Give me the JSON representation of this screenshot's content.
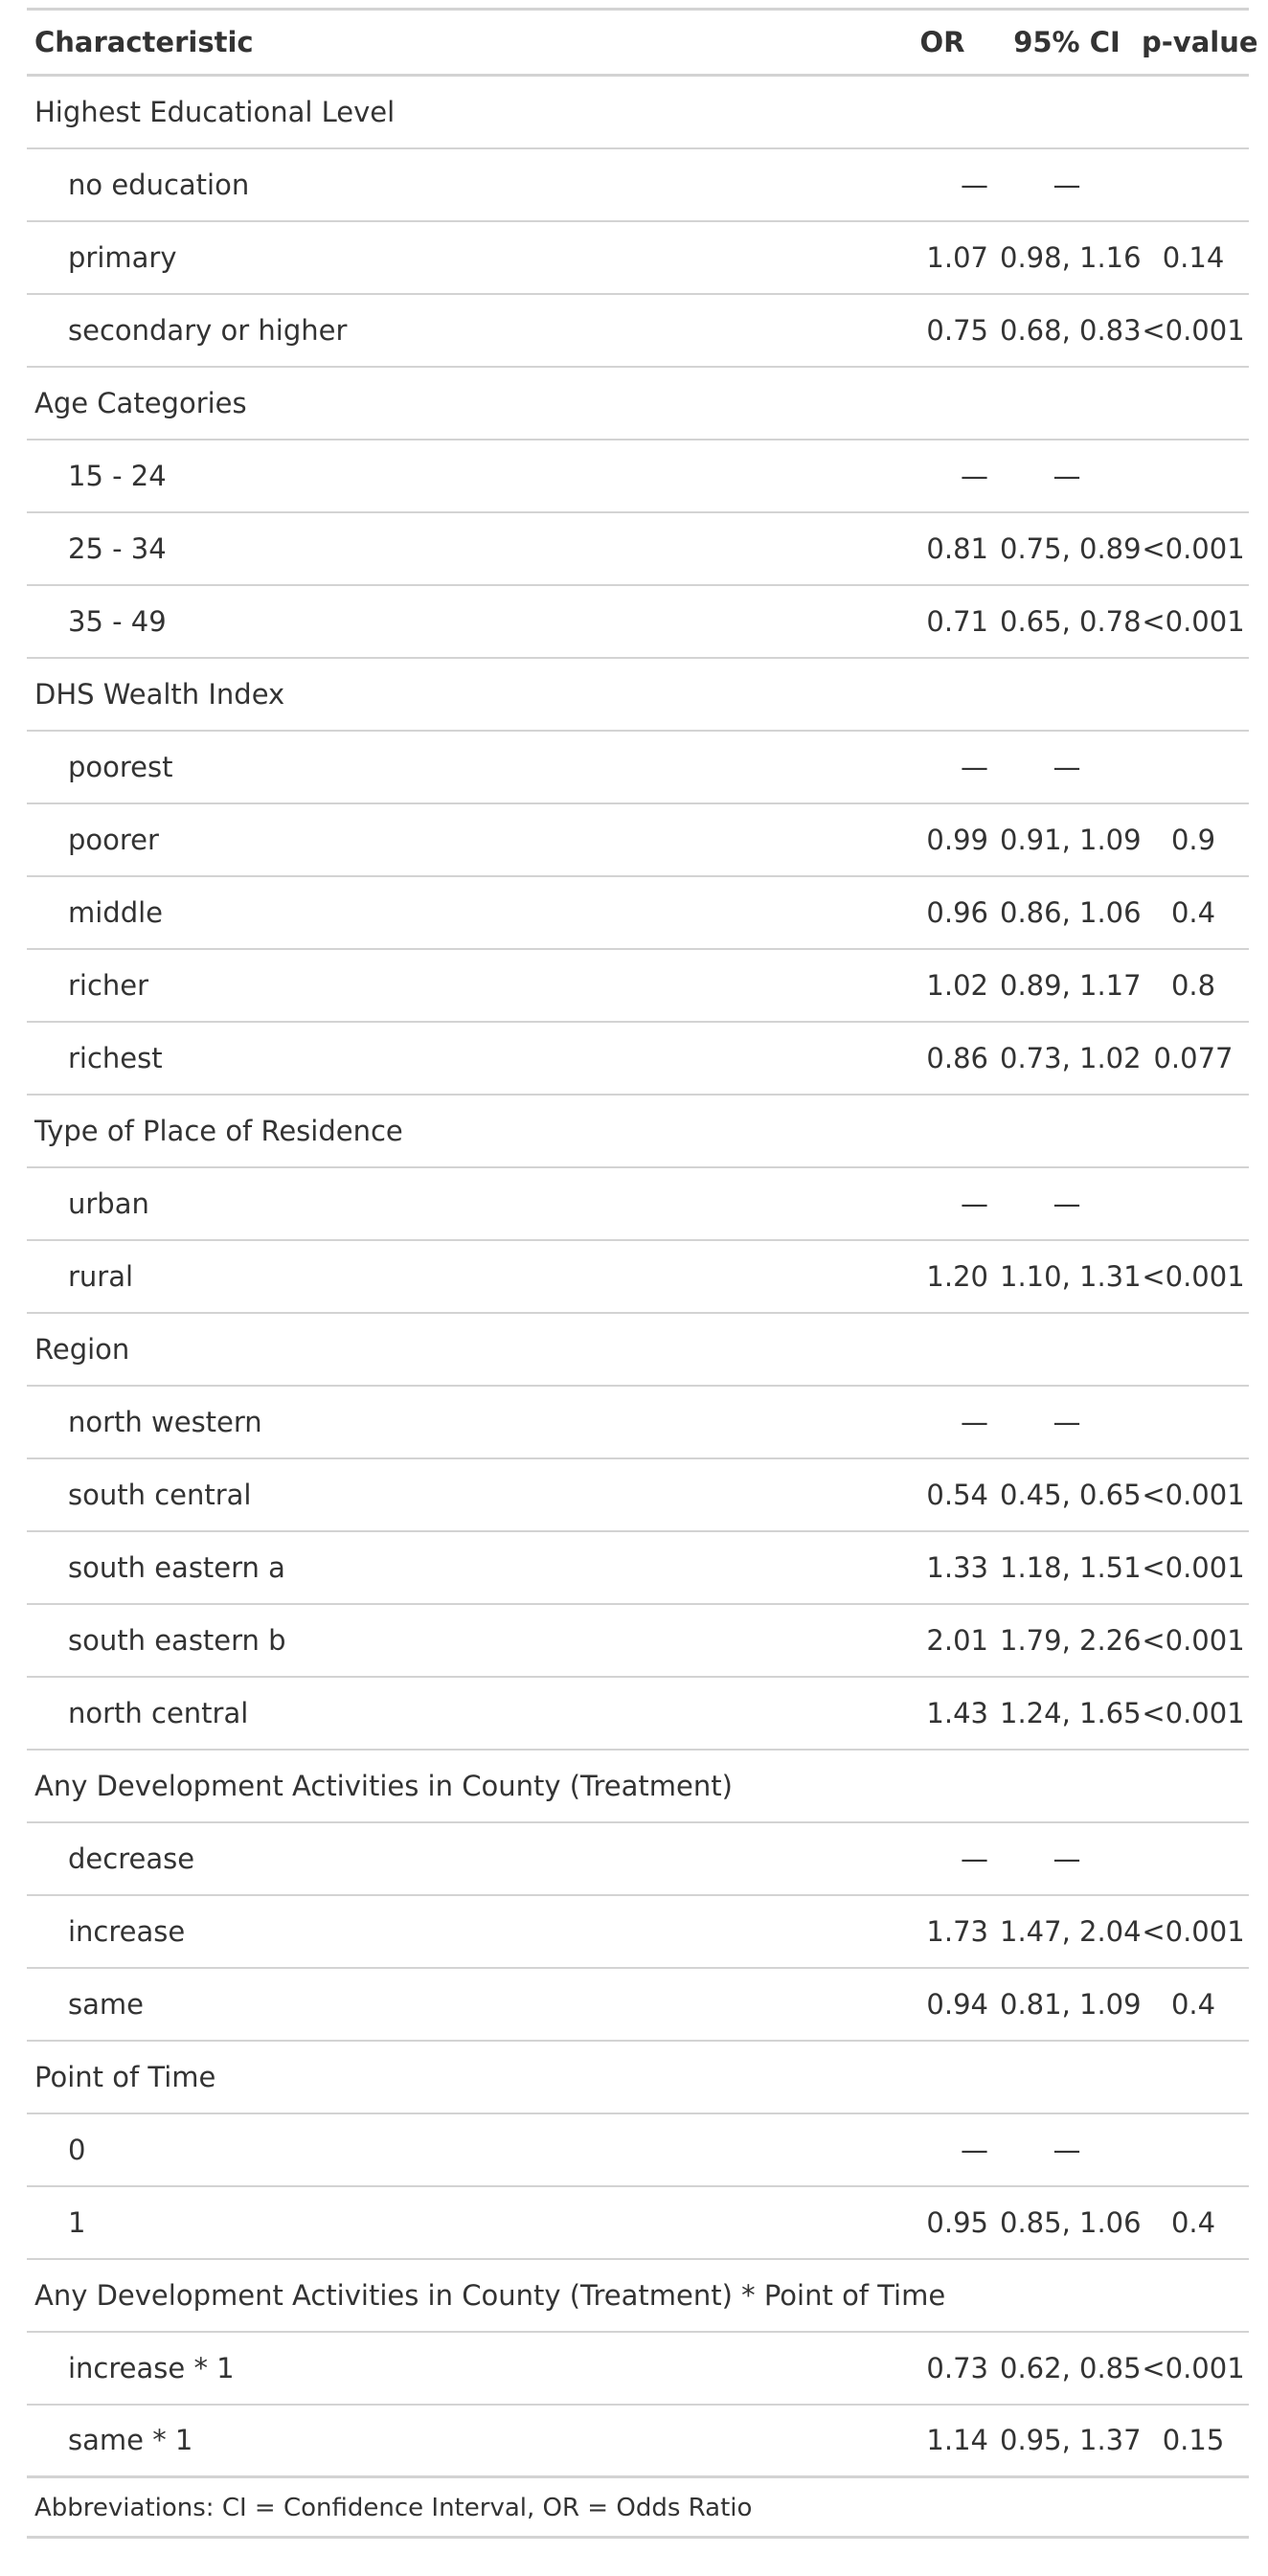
{
  "header": {
    "characteristic": "Characteristic",
    "or": "OR",
    "ci": "95% CI",
    "p": "p-value"
  },
  "rows": [
    {
      "kind": "group",
      "label": "Highest Educational Level",
      "or": "",
      "ci": "",
      "p": ""
    },
    {
      "kind": "level",
      "label": "no education",
      "or": "—",
      "ci": "—",
      "p": ""
    },
    {
      "kind": "level",
      "label": "primary",
      "or": "1.07",
      "ci": "0.98, 1.16",
      "p": "0.14"
    },
    {
      "kind": "level",
      "label": "secondary or higher",
      "or": "0.75",
      "ci": "0.68, 0.83",
      "p": "<0.001"
    },
    {
      "kind": "group",
      "label": "Age Categories",
      "or": "",
      "ci": "",
      "p": ""
    },
    {
      "kind": "level",
      "label": "15 - 24",
      "or": "—",
      "ci": "—",
      "p": ""
    },
    {
      "kind": "level",
      "label": "25 - 34",
      "or": "0.81",
      "ci": "0.75, 0.89",
      "p": "<0.001"
    },
    {
      "kind": "level",
      "label": "35 - 49",
      "or": "0.71",
      "ci": "0.65, 0.78",
      "p": "<0.001"
    },
    {
      "kind": "group",
      "label": "DHS Wealth Index",
      "or": "",
      "ci": "",
      "p": ""
    },
    {
      "kind": "level",
      "label": "poorest",
      "or": "—",
      "ci": "—",
      "p": ""
    },
    {
      "kind": "level",
      "label": "poorer",
      "or": "0.99",
      "ci": "0.91, 1.09",
      "p": "0.9"
    },
    {
      "kind": "level",
      "label": "middle",
      "or": "0.96",
      "ci": "0.86, 1.06",
      "p": "0.4"
    },
    {
      "kind": "level",
      "label": "richer",
      "or": "1.02",
      "ci": "0.89, 1.17",
      "p": "0.8"
    },
    {
      "kind": "level",
      "label": "richest",
      "or": "0.86",
      "ci": "0.73, 1.02",
      "p": "0.077"
    },
    {
      "kind": "group",
      "label": "Type of Place of Residence",
      "or": "",
      "ci": "",
      "p": ""
    },
    {
      "kind": "level",
      "label": "urban",
      "or": "—",
      "ci": "—",
      "p": ""
    },
    {
      "kind": "level",
      "label": "rural",
      "or": "1.20",
      "ci": "1.10, 1.31",
      "p": "<0.001"
    },
    {
      "kind": "group",
      "label": "Region",
      "or": "",
      "ci": "",
      "p": ""
    },
    {
      "kind": "level",
      "label": "north western",
      "or": "—",
      "ci": "—",
      "p": ""
    },
    {
      "kind": "level",
      "label": "south central",
      "or": "0.54",
      "ci": "0.45, 0.65",
      "p": "<0.001"
    },
    {
      "kind": "level",
      "label": "south eastern a",
      "or": "1.33",
      "ci": "1.18, 1.51",
      "p": "<0.001"
    },
    {
      "kind": "level",
      "label": "south eastern b",
      "or": "2.01",
      "ci": "1.79, 2.26",
      "p": "<0.001"
    },
    {
      "kind": "level",
      "label": "north central",
      "or": "1.43",
      "ci": "1.24, 1.65",
      "p": "<0.001"
    },
    {
      "kind": "group",
      "label": "Any Development Activities in County (Treatment)",
      "or": "",
      "ci": "",
      "p": ""
    },
    {
      "kind": "level",
      "label": "decrease",
      "or": "—",
      "ci": "—",
      "p": ""
    },
    {
      "kind": "level",
      "label": "increase",
      "or": "1.73",
      "ci": "1.47, 2.04",
      "p": "<0.001"
    },
    {
      "kind": "level",
      "label": "same",
      "or": "0.94",
      "ci": "0.81, 1.09",
      "p": "0.4"
    },
    {
      "kind": "group",
      "label": "Point of Time",
      "or": "",
      "ci": "",
      "p": ""
    },
    {
      "kind": "level",
      "label": "0",
      "or": "—",
      "ci": "—",
      "p": ""
    },
    {
      "kind": "level",
      "label": "1",
      "or": "0.95",
      "ci": "0.85, 1.06",
      "p": "0.4"
    },
    {
      "kind": "group",
      "label": "Any Development Activities in County (Treatment) * Point of Time",
      "or": "",
      "ci": "",
      "p": ""
    },
    {
      "kind": "level",
      "label": "increase * 1",
      "or": "0.73",
      "ci": "0.62, 0.85",
      "p": "<0.001"
    },
    {
      "kind": "level",
      "label": "same * 1",
      "or": "1.14",
      "ci": "0.95, 1.37",
      "p": "0.15"
    }
  ],
  "footnote": "Abbreviations: CI = Confidence Interval, OR = Odds Ratio"
}
